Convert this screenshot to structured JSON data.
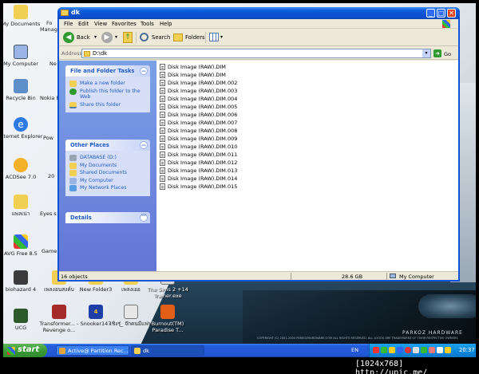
{
  "desktop": {
    "icons": [
      {
        "label": "My Documents",
        "icon": "my-documents-icon"
      },
      {
        "label": "My Computer",
        "icon": "my-computer-icon"
      },
      {
        "label": "Recycle Bin",
        "icon": "recycle-bin-icon"
      },
      {
        "label": "Internet Explorer",
        "icon": "internet-explorer-icon"
      },
      {
        "label": "ACDSee 7.0",
        "icon": "acdsee-icon"
      },
      {
        "label": "แพลเน่า",
        "icon": "folder-icon"
      },
      {
        "label": "AVG Free 8.5",
        "icon": "avg-icon"
      },
      {
        "label": "biohazard 4",
        "icon": "game-cover-icon"
      },
      {
        "label": "UCG",
        "icon": "monitor-icon"
      },
      {
        "label": "เพลงอนสงค์บ",
        "icon": "folder-icon"
      },
      {
        "label": "Transformer... - Revenge o...",
        "icon": "transformers-icon"
      },
      {
        "label": "New Folder3",
        "icon": "folder-icon"
      },
      {
        "label": "Snooker147",
        "icon": "snooker-icon"
      },
      {
        "label": "เพลงเออ",
        "icon": "folder-icon"
      },
      {
        "label": "เชิงรุ่_ จ๊กคนมีแฟน",
        "icon": "video-file-icon"
      },
      {
        "label": "The Sims 2 +14 Trainer.exe",
        "icon": "exe-icon"
      },
      {
        "label": "Burnout(TM) Paradise T...",
        "icon": "burnout-icon"
      }
    ],
    "partial_labels": [
      "Fo",
      "Manag",
      "Ne",
      "Nokia P",
      "Pow",
      "20",
      "Eyes s",
      "Game"
    ],
    "brand_title": "PARKOZ HARDWARE",
    "brand_copy": "COPYRIGHT (C) 2001-2004 PARKOZHARDWARE.COM ALL RIGHTS RESERVED. ALL LOGOS ARE TRADEMARKS OF THEIR RESPECTIVE OWNERS"
  },
  "window": {
    "title": "dk",
    "menu": [
      "File",
      "Edit",
      "View",
      "Favorites",
      "Tools",
      "Help"
    ],
    "toolbar": {
      "back_label": "Back",
      "search_label": "Search",
      "folders_label": "Folders"
    },
    "address": {
      "label": "Address",
      "value": "D:\\dk",
      "go_label": "Go"
    },
    "tasks_panel": {
      "title": "File and Folder Tasks",
      "items": [
        {
          "label": "Make a new folder",
          "icon": "new-folder-icon"
        },
        {
          "label": "Publish this folder to the Web",
          "icon": "publish-web-icon"
        },
        {
          "label": "Share this folder",
          "icon": "share-folder-icon"
        }
      ]
    },
    "places_panel": {
      "title": "Other Places",
      "items": [
        {
          "label": "DATABASE (D:)",
          "icon": "drive-icon",
          "bold": true
        },
        {
          "label": "My Documents",
          "icon": "my-documents-icon",
          "bold": false
        },
        {
          "label": "Shared Documents",
          "icon": "shared-documents-icon",
          "bold": false
        },
        {
          "label": "My Computer",
          "icon": "my-computer-icon",
          "bold": false
        },
        {
          "label": "My Network Places",
          "icon": "network-places-icon",
          "bold": false
        }
      ]
    },
    "details_panel": {
      "title": "Details"
    },
    "files": [
      "Disk Image (RAW).DIM",
      "Disk Image (RAW).DIM",
      "Disk Image (RAW).DIM.002",
      "Disk Image (RAW).DIM.003",
      "Disk Image (RAW).DIM.004",
      "Disk Image (RAW).DIM.005",
      "Disk Image (RAW).DIM.006",
      "Disk Image (RAW).DIM.007",
      "Disk Image (RAW).DIM.008",
      "Disk Image (RAW).DIM.009",
      "Disk Image (RAW).DIM.010",
      "Disk Image (RAW).DIM.011",
      "Disk Image (RAW).DIM.012",
      "Disk Image (RAW).DIM.013",
      "Disk Image (RAW).DIM.014",
      "Disk Image (RAW).DIM.015"
    ],
    "status": {
      "objects": "16 objects",
      "size": "28.6 GB",
      "location": "My Computer"
    }
  },
  "taskbar": {
    "start_label": "start",
    "tasks": [
      {
        "label": "Active@ Partition Rec...",
        "icon": "partition-recovery-icon",
        "active": false
      },
      {
        "label": "dk",
        "icon": "folder-icon",
        "active": true
      }
    ],
    "language": "EN",
    "clock": "20:37"
  },
  "watermark": "[1024x768] http://upic.me/"
}
